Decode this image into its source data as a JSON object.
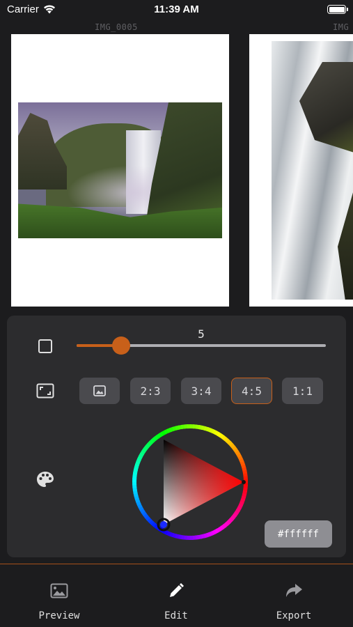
{
  "status_bar": {
    "carrier": "Carrier",
    "time": "11:39 AM",
    "wifi_icon": "wifi-icon",
    "battery_icon": "battery-icon"
  },
  "carousel": {
    "pages": [
      {
        "filename": "IMG_0005"
      },
      {
        "filename": "IMG"
      }
    ]
  },
  "controls": {
    "border_icon": "square-icon",
    "border_slider": {
      "value": "5",
      "fraction": 0.18
    },
    "aspect_icon": "fullscreen-icon",
    "aspect_options": [
      {
        "label": "",
        "icon": "image-icon",
        "selected": false
      },
      {
        "label": "2:3",
        "selected": false
      },
      {
        "label": "3:4",
        "selected": false
      },
      {
        "label": "4:5",
        "selected": true
      },
      {
        "label": "1:1",
        "selected": false
      }
    ],
    "color_icon": "palette-icon",
    "hex_value": "#ffffff"
  },
  "tab_bar": {
    "tabs": [
      {
        "label": "Preview",
        "icon": "image-icon"
      },
      {
        "label": "Edit",
        "icon": "pencil-icon"
      },
      {
        "label": "Export",
        "icon": "share-arrow-icon"
      }
    ]
  },
  "colors": {
    "background": "#1c1c1e",
    "panel": "#2c2c2e",
    "accent": "#c8601a",
    "button": "#4a4a4e",
    "hex_button": "#8e8e93"
  }
}
